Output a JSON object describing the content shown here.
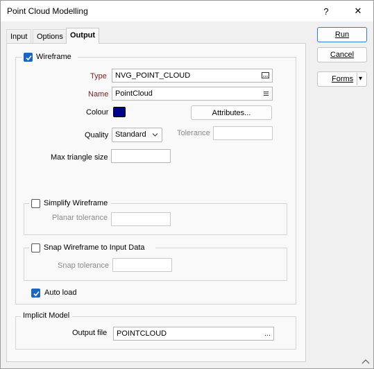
{
  "window": {
    "title": "Point Cloud Modelling",
    "help_label": "?",
    "close_label": "✕"
  },
  "tabs": [
    {
      "label": "Input",
      "active": false
    },
    {
      "label": "Options",
      "active": false
    },
    {
      "label": "Output",
      "active": true
    }
  ],
  "actions": {
    "run_label": "Run",
    "cancel_label": "Cancel",
    "forms_label": "Forms",
    "forms_dropdown": "▾"
  },
  "wireframe": {
    "checkbox_label": "Wireframe",
    "checked": true,
    "type_label": "Type",
    "type_value": "NVG_POINT_CLOUD",
    "type_icon": "browse-icon",
    "name_label": "Name",
    "name_value": "PointCloud",
    "name_icon": "list-icon",
    "colour_label": "Colour",
    "colour_value": "#00008b",
    "attributes_label": "Attributes...",
    "quality_label": "Quality",
    "quality_value": "Standard",
    "tolerance_label": "Tolerance",
    "tolerance_value": "",
    "max_triangle_label": "Max triangle size",
    "max_triangle_value": ""
  },
  "simplify": {
    "checkbox_label": "Simplify Wireframe",
    "checked": false,
    "planar_tolerance_label": "Planar tolerance",
    "planar_tolerance_value": ""
  },
  "snap": {
    "checkbox_label": "Snap Wireframe to Input Data",
    "checked": false,
    "snap_tolerance_label": "Snap tolerance",
    "snap_tolerance_value": ""
  },
  "autoload": {
    "checkbox_label": "Auto load",
    "checked": true
  },
  "implicit": {
    "group_label": "Implicit Model",
    "output_file_label": "Output file",
    "output_file_value": "POINTCLOUD",
    "output_file_icon": "..."
  },
  "colors": {
    "accent": "#1a66c2",
    "required_label": "#7a1c1c",
    "swatch": "#00008b"
  }
}
